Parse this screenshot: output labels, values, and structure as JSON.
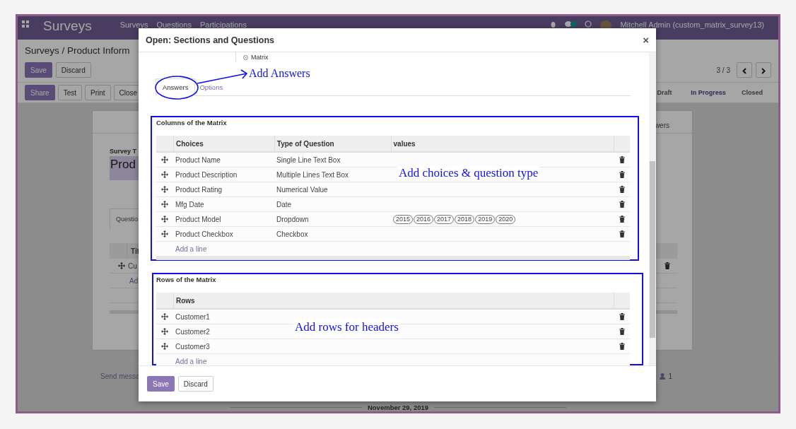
{
  "app": {
    "brand": "Surveys",
    "menus": [
      "Surveys",
      "Questions",
      "Participations"
    ],
    "user": "Mitchell Admin (custom_matrix_survey13)"
  },
  "control_panel": {
    "breadcrumb": "Surveys / Product Inform",
    "buttons": [
      "Save",
      "Discard"
    ],
    "pager": "3 / 3",
    "actions": [
      "Share",
      "Test",
      "Print",
      "Close"
    ],
    "stages": [
      {
        "label": "Draft",
        "selected": false
      },
      {
        "label": "In Progress",
        "selected": true
      },
      {
        "label": "Closed",
        "selected": false
      }
    ]
  },
  "sheet": {
    "smart_button": "wers",
    "title_label": "Survey T",
    "title_value": "Prod",
    "tab": "Questio",
    "column_header": "Tit",
    "row": "Cu",
    "add_link": "Ad"
  },
  "chatter": {
    "send_message": "Send messa",
    "followers": "1",
    "date": "November 29, 2019"
  },
  "dialog": {
    "title": "Open: Sections and Questions",
    "close": "×",
    "question_type": {
      "label": "Matrix",
      "selected": true
    },
    "tabs": [
      {
        "label": "Answers",
        "selected": true
      },
      {
        "label": "Options",
        "selected": false
      }
    ],
    "columns_section": {
      "title": "Columns of the Matrix",
      "headers": [
        "Choices",
        "Type of Question",
        "values"
      ],
      "rows": [
        {
          "choice": "Product Name",
          "type": "Single Line Text Box"
        },
        {
          "choice": "Product Description",
          "type": "Multiple Lines Text Box"
        },
        {
          "choice": "Product Rating",
          "type": "Numerical Value"
        },
        {
          "choice": "Mfg Date",
          "type": "Date"
        },
        {
          "choice": "Product Model",
          "type": "Dropdown",
          "values": [
            "2015",
            "2016",
            "2017",
            "2018",
            "2019",
            "2020"
          ]
        },
        {
          "choice": "Product Checkbox",
          "type": "Checkbox"
        }
      ],
      "add_line": "Add a line"
    },
    "rows_section": {
      "title": "Rows of the Matrix",
      "header": "Rows",
      "rows": [
        "Customer1",
        "Customer2",
        "Customer3"
      ],
      "add_line": "Add a line"
    },
    "buttons": [
      "Save",
      "Discard"
    ]
  },
  "annotations": [
    {
      "text": "Add Answers"
    },
    {
      "text": "Add choices & question type"
    },
    {
      "text": "Add rows for headers"
    }
  ]
}
